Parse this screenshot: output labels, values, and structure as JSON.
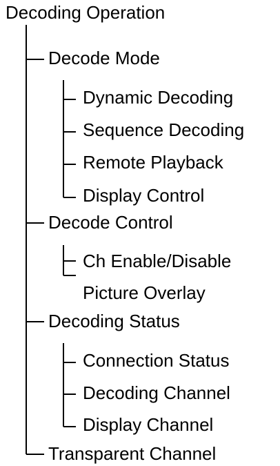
{
  "tree": {
    "root": "Decoding Operation",
    "children": [
      {
        "label": "Decode Mode",
        "items": [
          "Dynamic Decoding",
          "Sequence Decoding",
          "Remote Playback",
          "Display Control"
        ]
      },
      {
        "label": "Decode Control",
        "items": [
          "Ch Enable/Disable",
          "Picture Overlay"
        ]
      },
      {
        "label": "Decoding Status",
        "items": [
          "Connection Status",
          "Decoding Channel",
          "Display Channel"
        ]
      },
      {
        "label": "Transparent Channel",
        "items": []
      }
    ]
  }
}
